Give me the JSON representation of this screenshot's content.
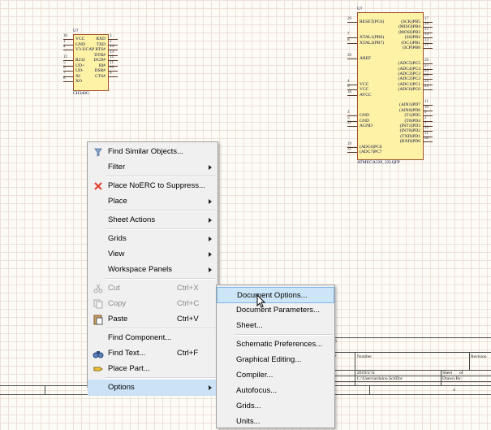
{
  "schematic": {
    "u1_small": {
      "designator": "U?",
      "name": "CH340G",
      "left_pins": [
        {
          "num": "16",
          "name": "VCC"
        },
        {
          "num": "1",
          "name": "GND"
        },
        {
          "num": "4",
          "name": "V3-UCAP"
        },
        {
          "num": "",
          "name": ""
        },
        {
          "num": "12",
          "name": "R232"
        },
        {
          "num": "5",
          "name": "UD+"
        },
        {
          "num": "6",
          "name": "UD-"
        },
        {
          "num": "7",
          "name": "XI"
        },
        {
          "num": "8",
          "name": "XO"
        }
      ],
      "right_pins": [
        {
          "num": "3",
          "name": "RXD"
        },
        {
          "num": "2",
          "name": "TXD"
        },
        {
          "num": "14",
          "name": "RTS#"
        },
        {
          "num": "13",
          "name": "DTR#"
        },
        {
          "num": "12",
          "name": "DCD#"
        },
        {
          "num": "11",
          "name": "RI#"
        },
        {
          "num": "10",
          "name": "DSR#"
        },
        {
          "num": "9",
          "name": "CTS#"
        }
      ]
    },
    "u1_big": {
      "designator": "U?",
      "name": "ATMEGA328_32LQFP",
      "left_pins": [
        {
          "num": "29",
          "name": "RESET(PC6)"
        },
        {
          "num": "",
          "name": ""
        },
        {
          "num": "",
          "name": ""
        },
        {
          "num": "7",
          "name": "XTAL1(PB6)"
        },
        {
          "num": "8",
          "name": "XTAL2(PB7)"
        },
        {
          "num": "",
          "name": ""
        },
        {
          "num": "",
          "name": ""
        },
        {
          "num": "20",
          "name": "AREF"
        },
        {
          "num": "",
          "name": ""
        },
        {
          "num": "",
          "name": ""
        },
        {
          "num": "",
          "name": ""
        },
        {
          "num": "",
          "name": ""
        },
        {
          "num": "4",
          "name": "VCC"
        },
        {
          "num": "6",
          "name": "VCC"
        },
        {
          "num": "18",
          "name": "AVCC"
        },
        {
          "num": "",
          "name": ""
        },
        {
          "num": "",
          "name": ""
        },
        {
          "num": "",
          "name": ""
        },
        {
          "num": "3",
          "name": "GND"
        },
        {
          "num": "5",
          "name": "GND"
        },
        {
          "num": "21",
          "name": "AGND"
        },
        {
          "num": "",
          "name": ""
        },
        {
          "num": "",
          "name": ""
        },
        {
          "num": "",
          "name": ""
        },
        {
          "num": "19",
          "name": "(ADC6)PC6"
        },
        {
          "num": "22",
          "name": "(ADC7)PC7"
        }
      ],
      "right_pins": [
        {
          "num": "17",
          "name": "(SCK)PB5"
        },
        {
          "num": "16",
          "name": "(MISO)PB4"
        },
        {
          "num": "15",
          "name": "(MOSI)PB3"
        },
        {
          "num": "14",
          "name": "(SS)PB2"
        },
        {
          "num": "13",
          "name": "(OC1)PB1"
        },
        {
          "num": "12",
          "name": "(ICP)PB0"
        },
        {
          "num": "",
          "name": ""
        },
        {
          "num": "",
          "name": ""
        },
        {
          "num": "28",
          "name": "(ADC5)PC5"
        },
        {
          "num": "27",
          "name": "(ADC4)PC4"
        },
        {
          "num": "26",
          "name": "(ADC3)PC3"
        },
        {
          "num": "25",
          "name": "(ADC2)PC2"
        },
        {
          "num": "24",
          "name": "(ADC1)PC1"
        },
        {
          "num": "23",
          "name": "(ADC0)PC0"
        },
        {
          "num": "",
          "name": ""
        },
        {
          "num": "",
          "name": ""
        },
        {
          "num": "11",
          "name": "(AIN1)PD7"
        },
        {
          "num": "10",
          "name": "(AIN0)PD6"
        },
        {
          "num": "9",
          "name": "(T1)PD5"
        },
        {
          "num": "2",
          "name": "(T0)PD4"
        },
        {
          "num": "1",
          "name": "(INT1)PD3"
        },
        {
          "num": "32",
          "name": "(INT0)PD2"
        },
        {
          "num": "31",
          "name": "(TXD)PD1"
        },
        {
          "num": "30",
          "name": "(RXD)PD0"
        }
      ]
    }
  },
  "context_menu": {
    "items": [
      {
        "label": "Find Similar Objects...",
        "shortcut": "",
        "submenu": false,
        "icon": "funnel-icon",
        "disabled": false
      },
      {
        "label": "Filter",
        "shortcut": "",
        "submenu": true,
        "icon": "",
        "disabled": false
      },
      {
        "sep": true
      },
      {
        "label": "Place NoERC to Suppress...",
        "shortcut": "",
        "submenu": false,
        "icon": "red-x-icon",
        "disabled": false
      },
      {
        "label": "Place",
        "shortcut": "",
        "submenu": true,
        "icon": "",
        "disabled": false
      },
      {
        "sep": true
      },
      {
        "label": "Sheet Actions",
        "shortcut": "",
        "submenu": true,
        "icon": "",
        "disabled": false
      },
      {
        "sep": true
      },
      {
        "label": "Grids",
        "shortcut": "",
        "submenu": true,
        "icon": "",
        "disabled": false
      },
      {
        "label": "View",
        "shortcut": "",
        "submenu": true,
        "icon": "",
        "disabled": false
      },
      {
        "label": "Workspace Panels",
        "shortcut": "",
        "submenu": true,
        "icon": "",
        "disabled": false
      },
      {
        "sep": true
      },
      {
        "label": "Cut",
        "shortcut": "Ctrl+X",
        "submenu": false,
        "icon": "scissors-icon",
        "disabled": true
      },
      {
        "label": "Copy",
        "shortcut": "Ctrl+C",
        "submenu": false,
        "icon": "copy-icon",
        "disabled": true
      },
      {
        "label": "Paste",
        "shortcut": "Ctrl+V",
        "submenu": false,
        "icon": "paste-icon",
        "disabled": false
      },
      {
        "sep": true
      },
      {
        "label": "Find Component...",
        "shortcut": "",
        "submenu": false,
        "icon": "",
        "disabled": false
      },
      {
        "label": "Find Text...",
        "shortcut": "Ctrl+F",
        "submenu": false,
        "icon": "binoculars-icon",
        "disabled": false
      },
      {
        "label": "Place Part...",
        "shortcut": "",
        "submenu": false,
        "icon": "place-part-icon",
        "disabled": false
      },
      {
        "sep": true
      },
      {
        "label": "Options",
        "shortcut": "",
        "submenu": true,
        "icon": "",
        "disabled": false,
        "highlighted": true
      }
    ]
  },
  "submenu": {
    "items": [
      {
        "label": "Document Options...",
        "highlighted": true
      },
      {
        "label": "Document Parameters..."
      },
      {
        "label": "Sheet..."
      },
      {
        "sep": true
      },
      {
        "label": "Schematic Preferences..."
      },
      {
        "label": "Graphical Editing..."
      },
      {
        "label": "Compiler..."
      },
      {
        "label": "Autofocus..."
      },
      {
        "label": "Grids..."
      },
      {
        "label": "Units..."
      }
    ]
  },
  "title_block": {
    "number_label": "Number",
    "revision_label": "Revision",
    "date": "2019/5/11",
    "sheet_label": "Sheet",
    "of_label": "of",
    "file": "C:\\Users\\arduino.SchDoc",
    "drawn_by_label": "Drawn By:",
    "frame_col_2": "2",
    "frame_col_4": "4",
    "fragment_6": "6",
    "fragment_e": "e"
  }
}
